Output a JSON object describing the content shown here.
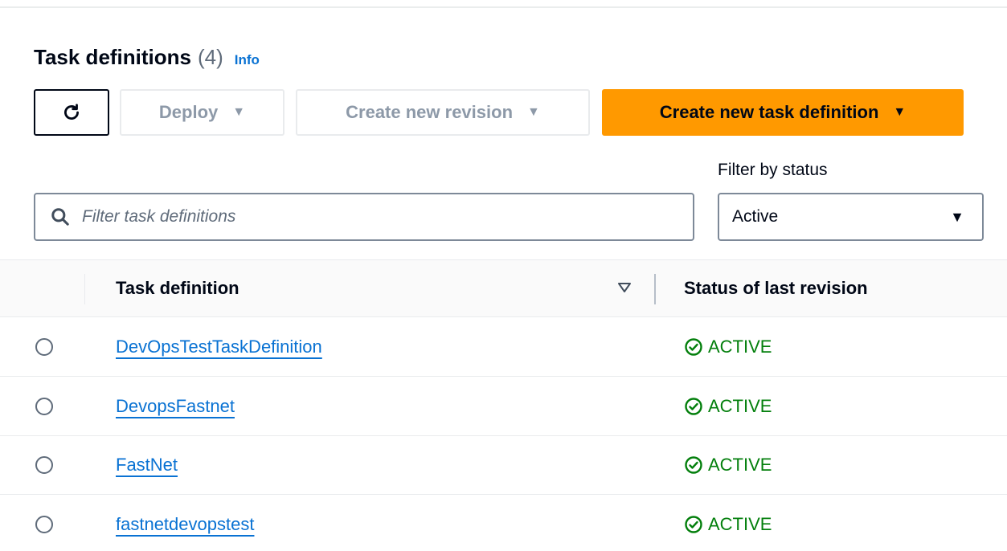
{
  "header": {
    "title": "Task definitions",
    "count": "(4)",
    "info_link": "Info"
  },
  "toolbar": {
    "refresh_icon": "refresh-icon",
    "deploy_label": "Deploy",
    "create_revision_label": "Create new revision",
    "create_task_label": "Create new task definition",
    "primary_color": "#ff9900"
  },
  "filter": {
    "search_placeholder": "Filter task definitions",
    "status_label": "Filter by status",
    "status_value": "Active"
  },
  "table": {
    "columns": {
      "task_definition": "Task definition",
      "status": "Status of last revision"
    },
    "rows": [
      {
        "name": "DevOpsTestTaskDefinition",
        "status": "ACTIVE"
      },
      {
        "name": "DevopsFastnet",
        "status": "ACTIVE"
      },
      {
        "name": "FastNet",
        "status": "ACTIVE"
      },
      {
        "name": "fastnetdevopstest",
        "status": "ACTIVE"
      }
    ],
    "link_color": "#0972d3",
    "status_color": "#037f0c"
  }
}
